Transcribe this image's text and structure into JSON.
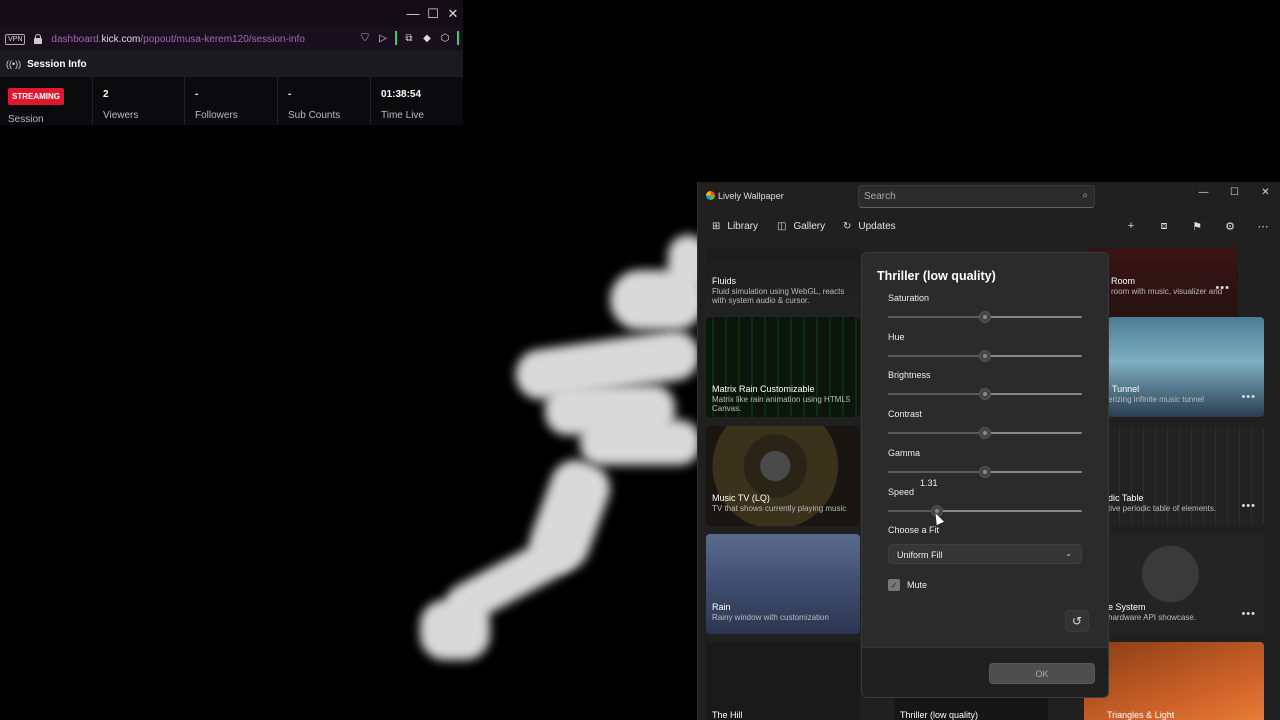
{
  "browser": {
    "window_controls": {
      "minimize": "—",
      "maximize": "☐",
      "close": "✕"
    },
    "vpn_label": "VPN",
    "url": {
      "prefix": "dashboard.",
      "domain": "kick.com",
      "path": "/popout/musa-kerem120/session-info"
    }
  },
  "session": {
    "header_title": "Session Info",
    "status_badge": "STREAMING",
    "status_sub": "Session",
    "stats": [
      {
        "value": "2",
        "label": "Viewers"
      },
      {
        "value": "-",
        "label": "Followers"
      },
      {
        "value": "-",
        "label": "Sub Counts"
      },
      {
        "value": "01:38:54",
        "label": "Time Live"
      }
    ]
  },
  "lively": {
    "app_name": "Lively Wallpaper",
    "search_placeholder": "Search",
    "nav": {
      "library": "Library",
      "gallery": "Gallery",
      "updates": "Updates"
    },
    "tiles": [
      {
        "name": "Fluids",
        "desc": "Fluid simulation using WebGL, reacts with system audio & cursor."
      },
      {
        "name": "Matrix Rain Customizable",
        "desc": "Matrix like rain animation using HTML5 Canvas."
      },
      {
        "name": "Music TV (LQ)",
        "desc": "TV that shows currently playing music"
      },
      {
        "name": "Rain",
        "desc": "Rainy window with customization"
      },
      {
        "name": "The Hill",
        "desc": ""
      },
      {
        "name": "Thriller (low quality)",
        "desc": ""
      },
      {
        "name": "Room",
        "desc": "room with music, visualizer and"
      },
      {
        "name": "Tunnel",
        "desc": "erizing infinite music tunnel"
      },
      {
        "name": "dic Table",
        "desc": "tive periodic table of elements."
      },
      {
        "name": "e System",
        "desc": "hardware API showcase."
      },
      {
        "name": "Triangles & Light",
        "desc": ""
      }
    ],
    "more_label": "•••",
    "dialog": {
      "title": "Thriller (low quality)",
      "sliders": [
        {
          "label": "Saturation",
          "value": 0.5
        },
        {
          "label": "Hue",
          "value": 0.5
        },
        {
          "label": "Brightness",
          "value": 0.5
        },
        {
          "label": "Contrast",
          "value": 0.5
        },
        {
          "label": "Gamma",
          "value": 0.5
        },
        {
          "label": "Speed",
          "value": 0.25
        }
      ],
      "speed_tooltip": "1.31",
      "fit_label": "Choose a Fit",
      "fit_value": "Uniform Fill",
      "mute_label": "Mute",
      "mute_checked": true,
      "ok_label": "OK"
    }
  }
}
